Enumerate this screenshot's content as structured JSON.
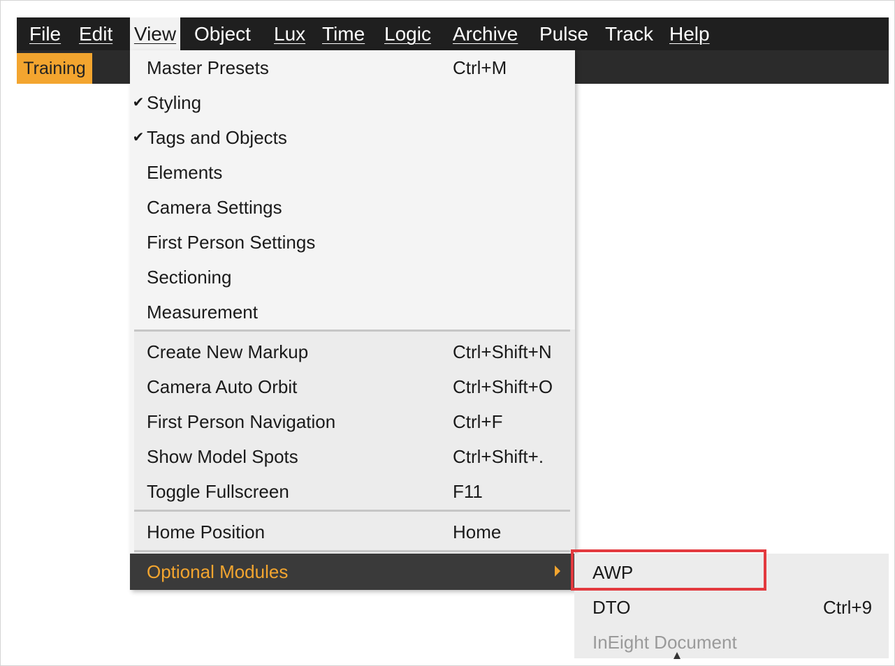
{
  "menubar": {
    "items": [
      {
        "label": "File"
      },
      {
        "label": "Edit"
      },
      {
        "label": "View",
        "active": true
      },
      {
        "label": "Object"
      },
      {
        "label": "Lux"
      },
      {
        "label": "Time"
      },
      {
        "label": "Logic"
      },
      {
        "label": "Archive"
      },
      {
        "label": "Pulse"
      },
      {
        "label": "Track"
      },
      {
        "label": "Help"
      }
    ]
  },
  "toolbar": {
    "tab_label": "Training"
  },
  "view_menu": {
    "items": [
      {
        "label": "Master Presets",
        "shortcut": "Ctrl+M",
        "checked": false
      },
      {
        "label": "Styling",
        "shortcut": "",
        "checked": true
      },
      {
        "label": "Tags and Objects",
        "shortcut": "",
        "checked": true
      },
      {
        "label": "Elements",
        "shortcut": "",
        "checked": false
      },
      {
        "label": "Camera Settings",
        "shortcut": "",
        "checked": false
      },
      {
        "label": "First Person Settings",
        "shortcut": "",
        "checked": false
      },
      {
        "label": "Sectioning",
        "shortcut": "",
        "checked": false
      },
      {
        "label": "Measurement",
        "shortcut": "",
        "checked": false
      },
      {
        "label": "Create New Markup",
        "shortcut": "Ctrl+Shift+N"
      },
      {
        "label": "Camera Auto Orbit",
        "shortcut": "Ctrl+Shift+O"
      },
      {
        "label": "First Person Navigation",
        "shortcut": "Ctrl+F"
      },
      {
        "label": "Show Model Spots",
        "shortcut": "Ctrl+Shift+."
      },
      {
        "label": "Toggle Fullscreen",
        "shortcut": "F11"
      },
      {
        "label": "Home Position",
        "shortcut": "Home"
      },
      {
        "label": "Optional Modules",
        "shortcut": "",
        "highlighted": true,
        "has_submenu": true
      }
    ],
    "check_glyph": "✔"
  },
  "optional_modules_submenu": {
    "items": [
      {
        "label": "AWP",
        "shortcut": "",
        "outlined": true
      },
      {
        "label": "DTO",
        "shortcut": "Ctrl+9"
      },
      {
        "label": "InEight Document",
        "shortcut": "",
        "disabled": true
      }
    ]
  },
  "colors": {
    "menubar_bg": "#1f1f1f",
    "accent_orange": "#f3a52f",
    "menu_bg": "#ececec",
    "highlight_bg": "#3a3a3a",
    "callout_red": "#e33a3f"
  }
}
